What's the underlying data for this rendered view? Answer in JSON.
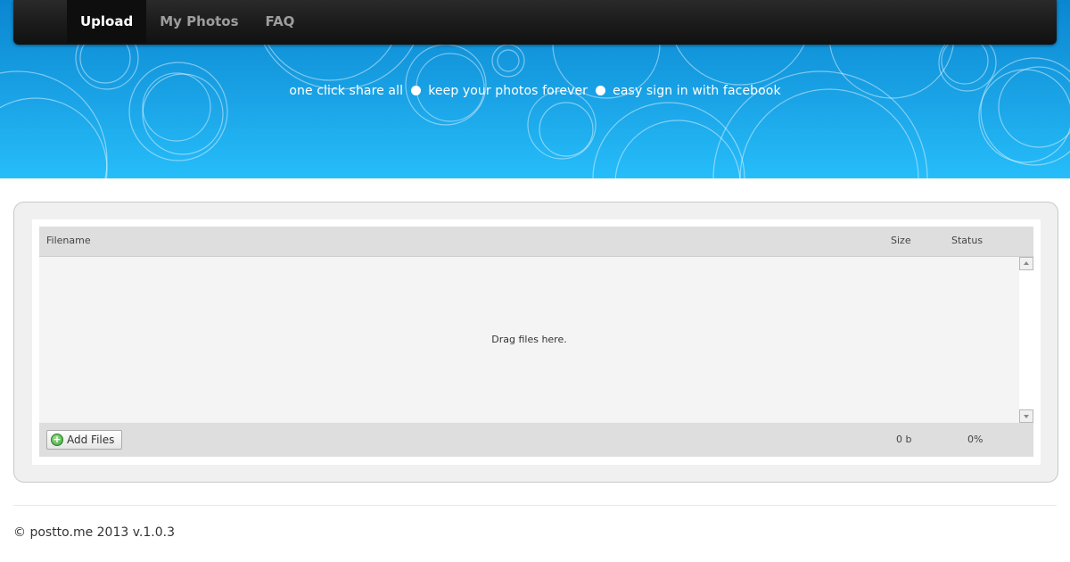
{
  "nav": {
    "items": [
      {
        "label": "Upload",
        "active": true
      },
      {
        "label": "My Photos",
        "active": false
      },
      {
        "label": "FAQ",
        "active": false
      }
    ]
  },
  "hero": {
    "tagline_parts": [
      "one click share all",
      "keep your photos forever",
      "easy sign in with facebook"
    ]
  },
  "uploader": {
    "headers": {
      "filename": "Filename",
      "size": "Size",
      "status": "Status"
    },
    "empty_text": "Drag files here.",
    "add_button_label": "Add Files",
    "total_size": "0 b",
    "total_progress": "0%"
  },
  "footer": {
    "copyright": "© postto.me 2013 v.1.0.3"
  },
  "colors": {
    "hero_top": "#0a86d0",
    "hero_bottom": "#26bdfa",
    "navbar": "#1c1c1c",
    "nav_active_text": "#ffffff",
    "nav_text": "#9d9d9d"
  }
}
